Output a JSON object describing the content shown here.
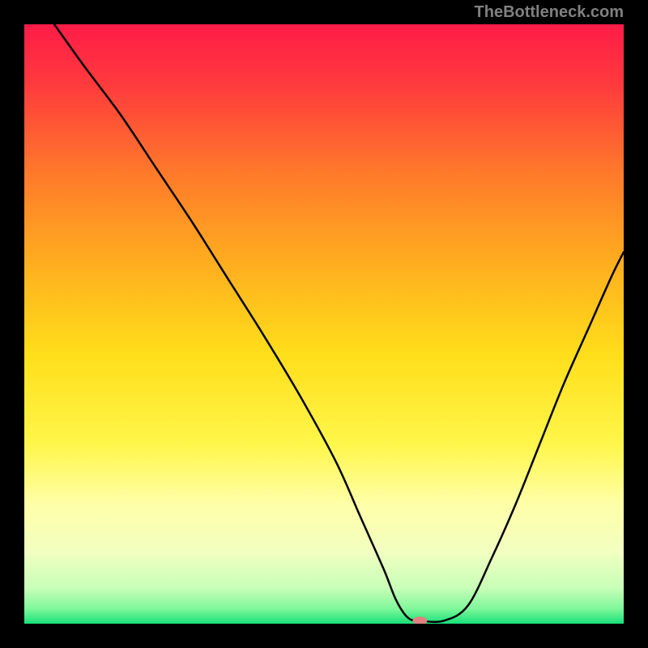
{
  "watermark": "TheBottleneck.com",
  "chart_data": {
    "type": "line",
    "title": "",
    "xlabel": "",
    "ylabel": "",
    "xlim": [
      0,
      100
    ],
    "ylim": [
      0,
      100
    ],
    "grid": false,
    "legend": false,
    "gradient_stops": [
      {
        "offset": 0,
        "color": "#ff1c48"
      },
      {
        "offset": 0.1,
        "color": "#ff3a3d"
      },
      {
        "offset": 0.25,
        "color": "#ff7a2a"
      },
      {
        "offset": 0.4,
        "color": "#ffae1f"
      },
      {
        "offset": 0.55,
        "color": "#ffde1a"
      },
      {
        "offset": 0.7,
        "color": "#fff64a"
      },
      {
        "offset": 0.8,
        "color": "#ffffa8"
      },
      {
        "offset": 0.88,
        "color": "#f2ffc0"
      },
      {
        "offset": 0.94,
        "color": "#c8ffb8"
      },
      {
        "offset": 0.975,
        "color": "#7ff79a"
      },
      {
        "offset": 1.0,
        "color": "#18e07a"
      }
    ],
    "series": [
      {
        "name": "bottleneck-curve",
        "x": [
          5,
          10,
          16,
          22,
          28,
          34,
          40,
          46,
          52,
          56,
          60,
          62,
          64,
          66,
          70,
          74,
          78,
          82,
          86,
          90,
          94,
          98,
          100
        ],
        "values": [
          100,
          93,
          85,
          76,
          67,
          57.5,
          48,
          38,
          27,
          18,
          9,
          4,
          1,
          0.5,
          0.5,
          3,
          11,
          20,
          30,
          40,
          49,
          58,
          62
        ]
      }
    ],
    "marker": {
      "x": 66,
      "y": 0.5,
      "color": "#e08080",
      "rx": 9,
      "ry": 5
    }
  }
}
